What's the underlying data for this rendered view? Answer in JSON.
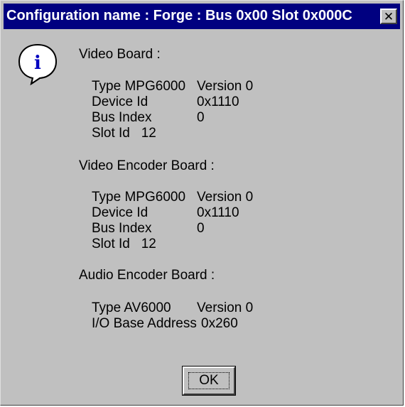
{
  "window": {
    "title": "Configuration name : Forge : Bus 0x00 Slot 0x000C",
    "close_label": "✕"
  },
  "icon": {
    "name": "information-icon",
    "glyph": "i",
    "color": "#0000c0"
  },
  "video_board": {
    "heading": "Video Board :",
    "type": "Type MPG6000",
    "version": "Version 0",
    "device_id_label": "Device Id",
    "device_id_value": "0x1110",
    "bus_index_label": "Bus Index",
    "bus_index_value": "0",
    "slot_id": "Slot Id   12"
  },
  "video_encoder_board": {
    "heading": "Video Encoder Board :",
    "type": "Type MPG6000",
    "version": "Version 0",
    "device_id_label": "Device Id",
    "device_id_value": "0x1110",
    "bus_index_label": "Bus Index",
    "bus_index_value": "0",
    "slot_id": "Slot Id   12"
  },
  "audio_encoder_board": {
    "heading": "Audio Encoder Board :",
    "type": "Type AV6000",
    "version": "Version 0",
    "io_base_label": "I/O Base Address",
    "io_base_value": "0x260"
  },
  "buttons": {
    "ok_label": "OK"
  }
}
